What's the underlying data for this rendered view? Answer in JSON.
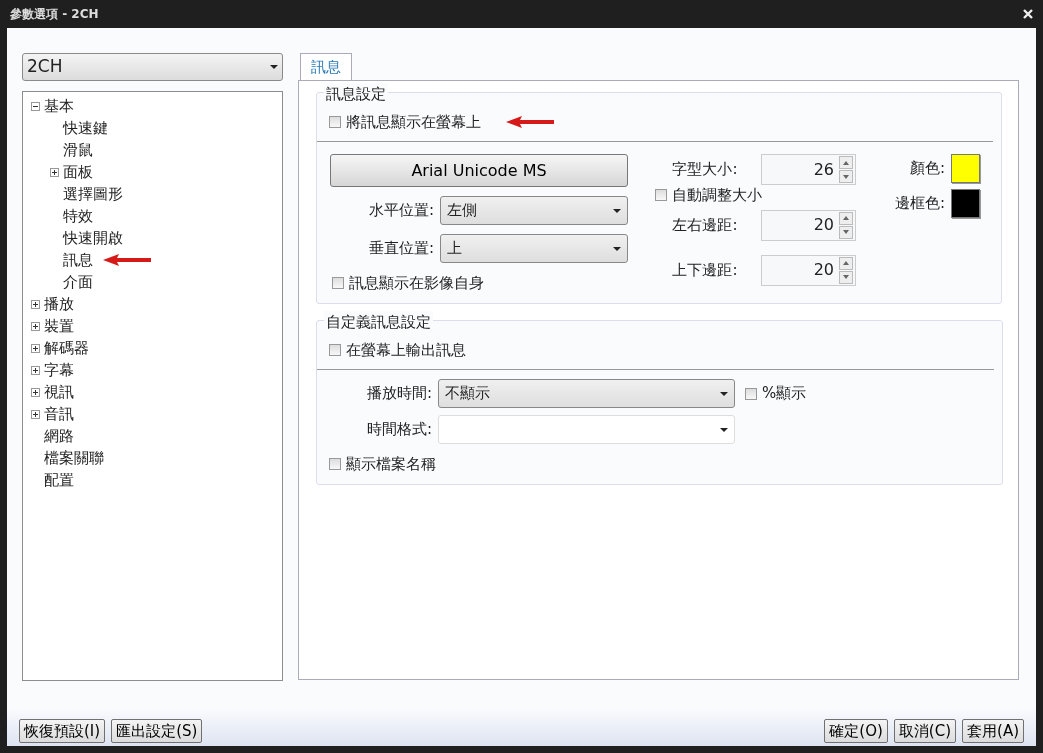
{
  "window": {
    "title": "參數選項 - 2CH"
  },
  "profile_select": {
    "value": "2CH"
  },
  "tree": [
    {
      "label": "基本",
      "expanded": true,
      "children": [
        {
          "label": "快速鍵"
        },
        {
          "label": "滑鼠"
        },
        {
          "label": "面板",
          "expanded": false
        },
        {
          "label": "選擇圖形"
        },
        {
          "label": "特效"
        },
        {
          "label": "快速開啟"
        },
        {
          "label": "訊息",
          "annotated": true
        },
        {
          "label": "介面"
        }
      ]
    },
    {
      "label": "播放",
      "expanded": false
    },
    {
      "label": "裝置",
      "expanded": false
    },
    {
      "label": "解碼器",
      "expanded": false
    },
    {
      "label": "字幕",
      "expanded": false
    },
    {
      "label": "視訊",
      "expanded": false
    },
    {
      "label": "音訊",
      "expanded": false
    },
    {
      "label": "網路"
    },
    {
      "label": "檔案關聯"
    },
    {
      "label": "配置"
    }
  ],
  "tabs": [
    {
      "label": "訊息",
      "selected": true
    }
  ],
  "message_settings": {
    "title": "訊息設定",
    "show_on_screen": {
      "label": "將訊息顯示在螢幕上",
      "checked": false,
      "annotated": true
    },
    "font_button": "Arial Unicode MS",
    "horizontal_position": {
      "label": "水平位置:",
      "value": "左側"
    },
    "vertical_position": {
      "label": "垂直位置:",
      "value": "上"
    },
    "show_on_video": {
      "label": "訊息顯示在影像自身",
      "checked": false
    },
    "font_size": {
      "label": "字型大小:",
      "value": "26"
    },
    "auto_size": {
      "label": "自動調整大小",
      "checked": false
    },
    "horizontal_margin": {
      "label": "左右邊距:",
      "value": "20"
    },
    "vertical_margin": {
      "label": "上下邊距:",
      "value": "20"
    },
    "text_color": {
      "label": "顏色:",
      "color": "#ffff00"
    },
    "border_color": {
      "label": "邊框色:",
      "color": "#000000"
    }
  },
  "custom_settings": {
    "title": "自定義訊息設定",
    "output_on_screen": {
      "label": "在螢幕上輸出訊息",
      "checked": false
    },
    "play_time": {
      "label": "播放時間:",
      "value": "不顯示"
    },
    "percent": {
      "label": "%顯示",
      "checked": false
    },
    "time_format": {
      "label": "時間格式:"
    },
    "show_filename": {
      "label": "顯示檔案名稱",
      "checked": false
    }
  },
  "footer": {
    "left_buttons": [
      "恢復預設(I)",
      "匯出設定(S)"
    ],
    "right_buttons": [
      "確定(O)",
      "取消(C)",
      "套用(A)"
    ]
  }
}
